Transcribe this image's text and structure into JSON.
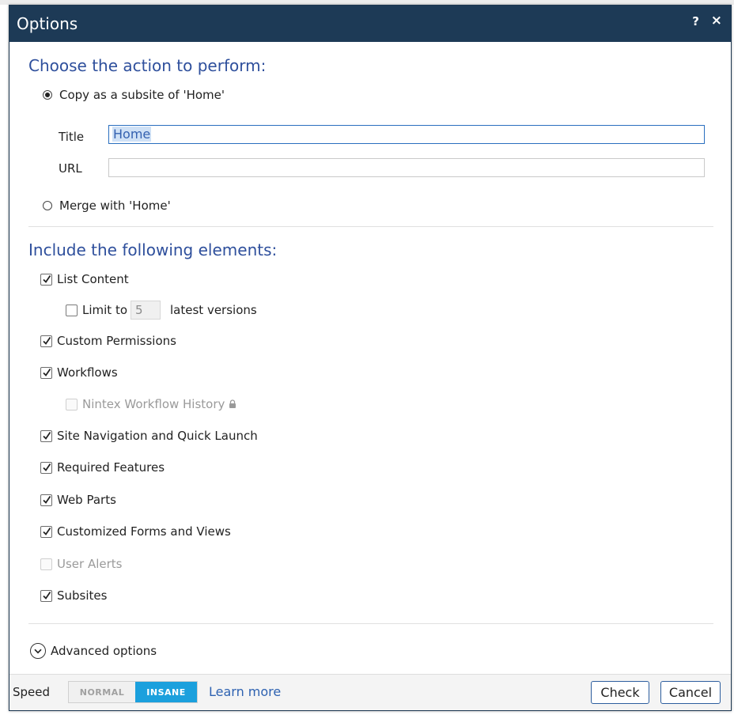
{
  "dialog": {
    "title": "Options",
    "help_label": "?",
    "close_label": "×"
  },
  "action_section": {
    "heading": "Choose the action to perform:",
    "copy_option": {
      "label": "Copy as a subsite of 'Home'",
      "selected": true
    },
    "title_field": {
      "label": "Title",
      "value": "Home"
    },
    "url_field": {
      "label": "URL",
      "value": ""
    },
    "merge_option": {
      "label": "Merge with 'Home'",
      "selected": false
    }
  },
  "elements_section": {
    "heading": "Include the following elements:",
    "items": [
      {
        "label": "List Content",
        "checked": true,
        "enabled": true
      },
      {
        "label": "Custom Permissions",
        "checked": true,
        "enabled": true
      },
      {
        "label": "Workflows",
        "checked": true,
        "enabled": true
      },
      {
        "label": "Site Navigation and Quick Launch",
        "checked": true,
        "enabled": true
      },
      {
        "label": "Required Features",
        "checked": true,
        "enabled": true
      },
      {
        "label": "Web Parts",
        "checked": true,
        "enabled": true
      },
      {
        "label": "Customized Forms and Views",
        "checked": true,
        "enabled": true
      },
      {
        "label": "User Alerts",
        "checked": false,
        "enabled": false
      },
      {
        "label": "Subsites",
        "checked": true,
        "enabled": true
      }
    ],
    "limit_versions": {
      "prefix": "Limit to",
      "value": "5",
      "suffix": "latest versions",
      "checked": false
    },
    "nintex_history": {
      "label": "Nintex Workflow History",
      "checked": false,
      "enabled": false,
      "icon": "lock-icon"
    }
  },
  "advanced": {
    "label": "Advanced options",
    "icon": "chevron-down-circle-icon"
  },
  "footer": {
    "speed_label": "Speed",
    "speed_options": [
      "NORMAL",
      "INSANE"
    ],
    "speed_selected": "INSANE",
    "learn_more": "Learn more",
    "check_button": "Check",
    "cancel_button": "Cancel"
  },
  "colors": {
    "titlebar": "#1d3a56",
    "heading": "#2e4f9c",
    "accent": "#1ba0dd",
    "link": "#2e62b1"
  }
}
